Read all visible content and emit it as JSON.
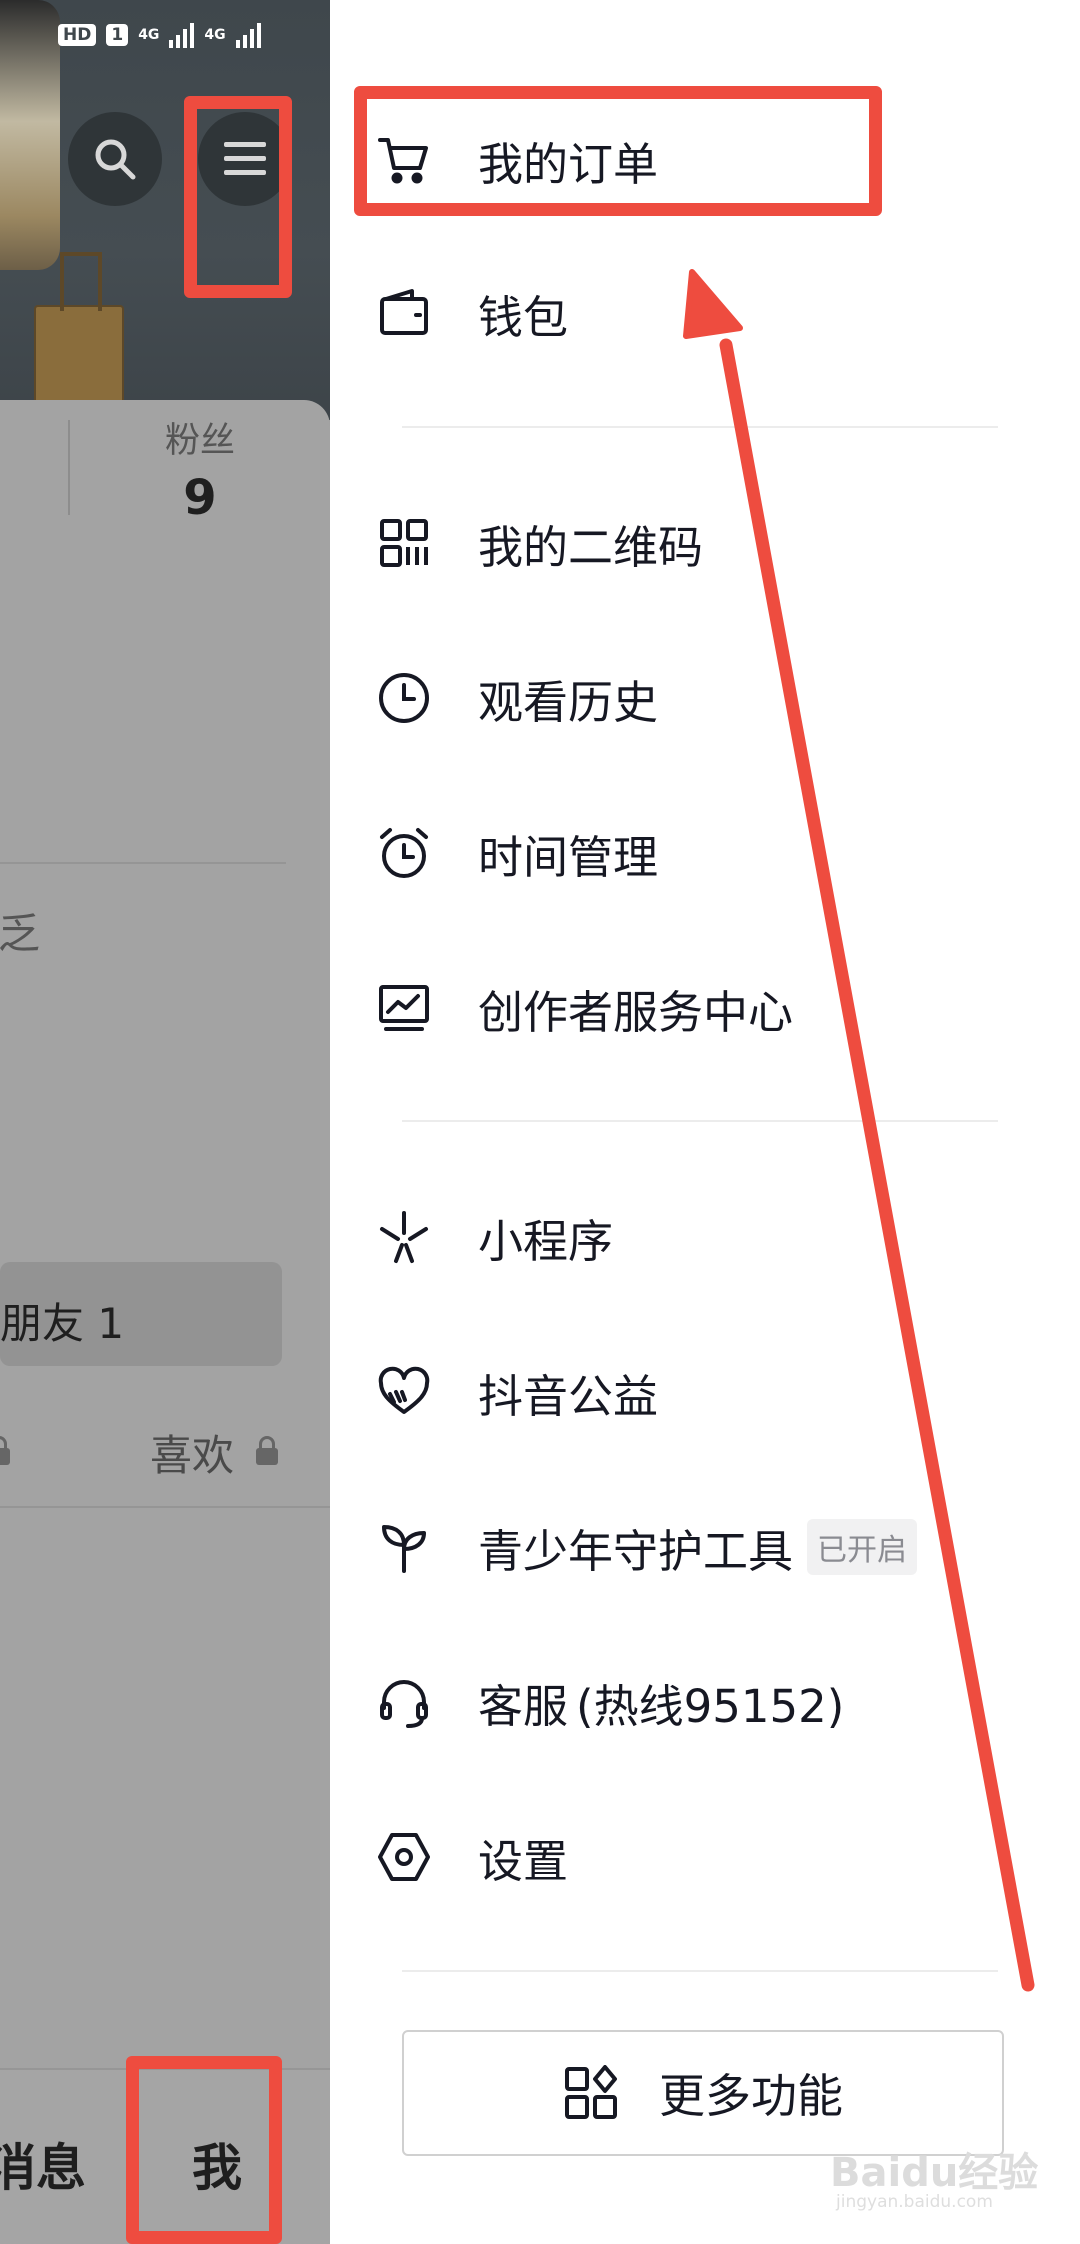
{
  "status_bar": {
    "hd_badge": "HD",
    "sim_badge": "1",
    "network_1": "4G",
    "network_2": "4G"
  },
  "profile": {
    "fans_label": "粉丝",
    "fans_count": "9",
    "friends_text": "朋友 1",
    "likes_label": "喜欢",
    "partial_glyph": "乏"
  },
  "bottom_nav": {
    "messages_partial": "消息",
    "me_label": "我"
  },
  "drawer": {
    "items": [
      {
        "label": "我的订单",
        "icon": "cart-icon"
      },
      {
        "label": "钱包",
        "icon": "wallet-icon"
      },
      {
        "label": "我的二维码",
        "icon": "qrcode-icon"
      },
      {
        "label": "观看历史",
        "icon": "clock-icon"
      },
      {
        "label": "时间管理",
        "icon": "alarm-clock-icon"
      },
      {
        "label": "创作者服务中心",
        "icon": "chart-monitor-icon"
      },
      {
        "label": "小程序",
        "icon": "mini-program-icon"
      },
      {
        "label": "抖音公益",
        "icon": "heart-hand-icon"
      },
      {
        "label": "青少年守护工具",
        "icon": "sprout-icon",
        "tag": "已开启"
      },
      {
        "label": "客服",
        "icon": "headset-icon",
        "hotline": "(热线95152)"
      },
      {
        "label": "设置",
        "icon": "settings-hexagon-icon"
      }
    ],
    "more_button": "更多功能"
  },
  "watermark": {
    "main": "Baidu经验",
    "sub": "jingyan.baidu.com"
  },
  "annotation_color": "#ee4c3f"
}
